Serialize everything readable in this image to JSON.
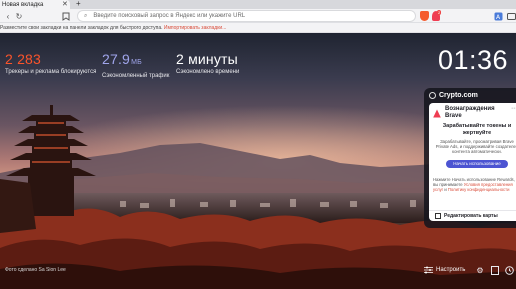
{
  "tab": {
    "title": "Новая вкладка",
    "close": "✕",
    "new_tab": "+"
  },
  "toolbar": {
    "back": "‹",
    "reload": "↻",
    "bookmark": "⎕",
    "search_icon": "⌕",
    "address_placeholder": "Введите поисковый запрос в Яндекс или укажите URL",
    "rewards_badge": "2"
  },
  "bookmarks_bar": {
    "text": "Разместите свои закладки на панели закладок для быстрого доступа.",
    "import_link": "Импортировать закладки..."
  },
  "stats": {
    "trackers": {
      "value": "2 283",
      "label": "Трекеры и реклама блокируются"
    },
    "bandwidth": {
      "value": "27.9",
      "unit": "МБ",
      "label": "Сэкономленный трафик"
    },
    "time": {
      "value": "2 минуты",
      "label": "Сэкономлено времени"
    }
  },
  "clock": "01:36",
  "widget": {
    "header": "Crypto.com",
    "title_line1": "Вознаграждения",
    "title_line2": "Brave",
    "subtitle": "Зарабатывайте токены и жертвуйте",
    "description": "Зарабатывайте, просматривая Brave Private Ads, и поддерживайте создателей контента автоматически.",
    "button": "Начать использование Rewards",
    "fine_print_1": "Нажмите Начать использование Rewards, вы принимаете",
    "terms_link": "Условия предоставления услуг",
    "fine_print_2": "и",
    "privacy_link": "Политику конфиденциальности",
    "edit": "Редактировать карты"
  },
  "photo_credit": "Фото сделано Sa Sion Lee",
  "settings_label": "Настроить",
  "colors": {
    "accent": "#4c54d2",
    "link": "#d94c3a",
    "trackers": "#fb542b",
    "bandwidth": "#a0a5eb"
  }
}
